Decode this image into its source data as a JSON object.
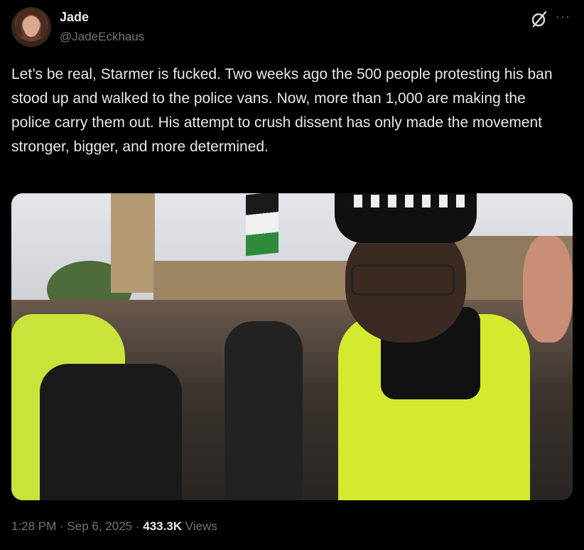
{
  "author": {
    "name": "Jade",
    "handle": "@JadeEckhaus",
    "avatar_icon": "profile-photo"
  },
  "header_icons": {
    "grok": "grok-icon",
    "more": "more-icon",
    "more_glyph": "···"
  },
  "tweet": {
    "text": "Let’s be real, Starmer is fucked. Two weeks ago the 500 people protesting his ban stood up and walked to the police vans. Now, more than 1,000 are making the police carry them out. His attempt to crush dissent has only made the movement stronger, bigger, and more determined."
  },
  "meta": {
    "time": "1:28 PM",
    "separator": " · ",
    "date": "Sep 6, 2025",
    "views_count": "433.3K",
    "views_label": " Views"
  },
  "colors": {
    "background": "#000000",
    "text_primary": "#e7e9ea",
    "text_secondary": "#71767b",
    "hi_vis_yellow": "#d3ea2e"
  }
}
